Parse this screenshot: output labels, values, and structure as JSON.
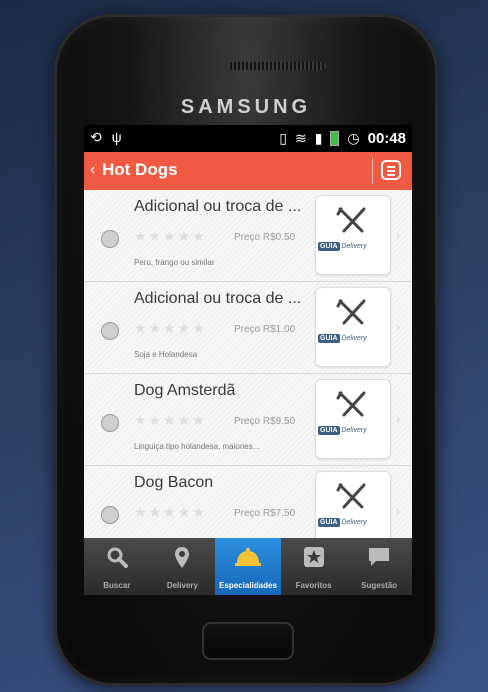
{
  "device": {
    "brand": "SAMSUNG"
  },
  "status_bar": {
    "time": "00:48",
    "battery_color": "#3cc13c"
  },
  "app_bar": {
    "back": "‹",
    "title": "Hot Dogs",
    "accent": "#f05a42"
  },
  "items": [
    {
      "name": "Adicional ou troca de ...",
      "price": "Preço R$0.50",
      "description": "Peru, frango ou similar",
      "rating": "★★★★★"
    },
    {
      "name": "Adicional ou troca de ...",
      "price": "Preço R$1.00",
      "description": "Soja e Holandesa",
      "rating": "★★★★★"
    },
    {
      "name": "Dog Amsterdã",
      "price": "Preço R$9.50",
      "description": "Linguiça tipo holandesa, maiones...",
      "rating": "★★★★★"
    },
    {
      "name": "Dog Bacon",
      "price": "Preço R$7.50",
      "description": "",
      "rating": "★★★★★"
    }
  ],
  "card_logo": {
    "guia": "GUIA",
    "delivery": "Delivery"
  },
  "tabs": [
    {
      "label": "Buscar",
      "icon": "search-icon"
    },
    {
      "label": "Delivery",
      "icon": "location-pin-icon"
    },
    {
      "label": "Especialidades",
      "icon": "cloche-icon"
    },
    {
      "label": "Favoritos",
      "icon": "star-icon"
    },
    {
      "label": "Sugestão",
      "icon": "chat-icon"
    }
  ],
  "active_tab": "Especialidades"
}
